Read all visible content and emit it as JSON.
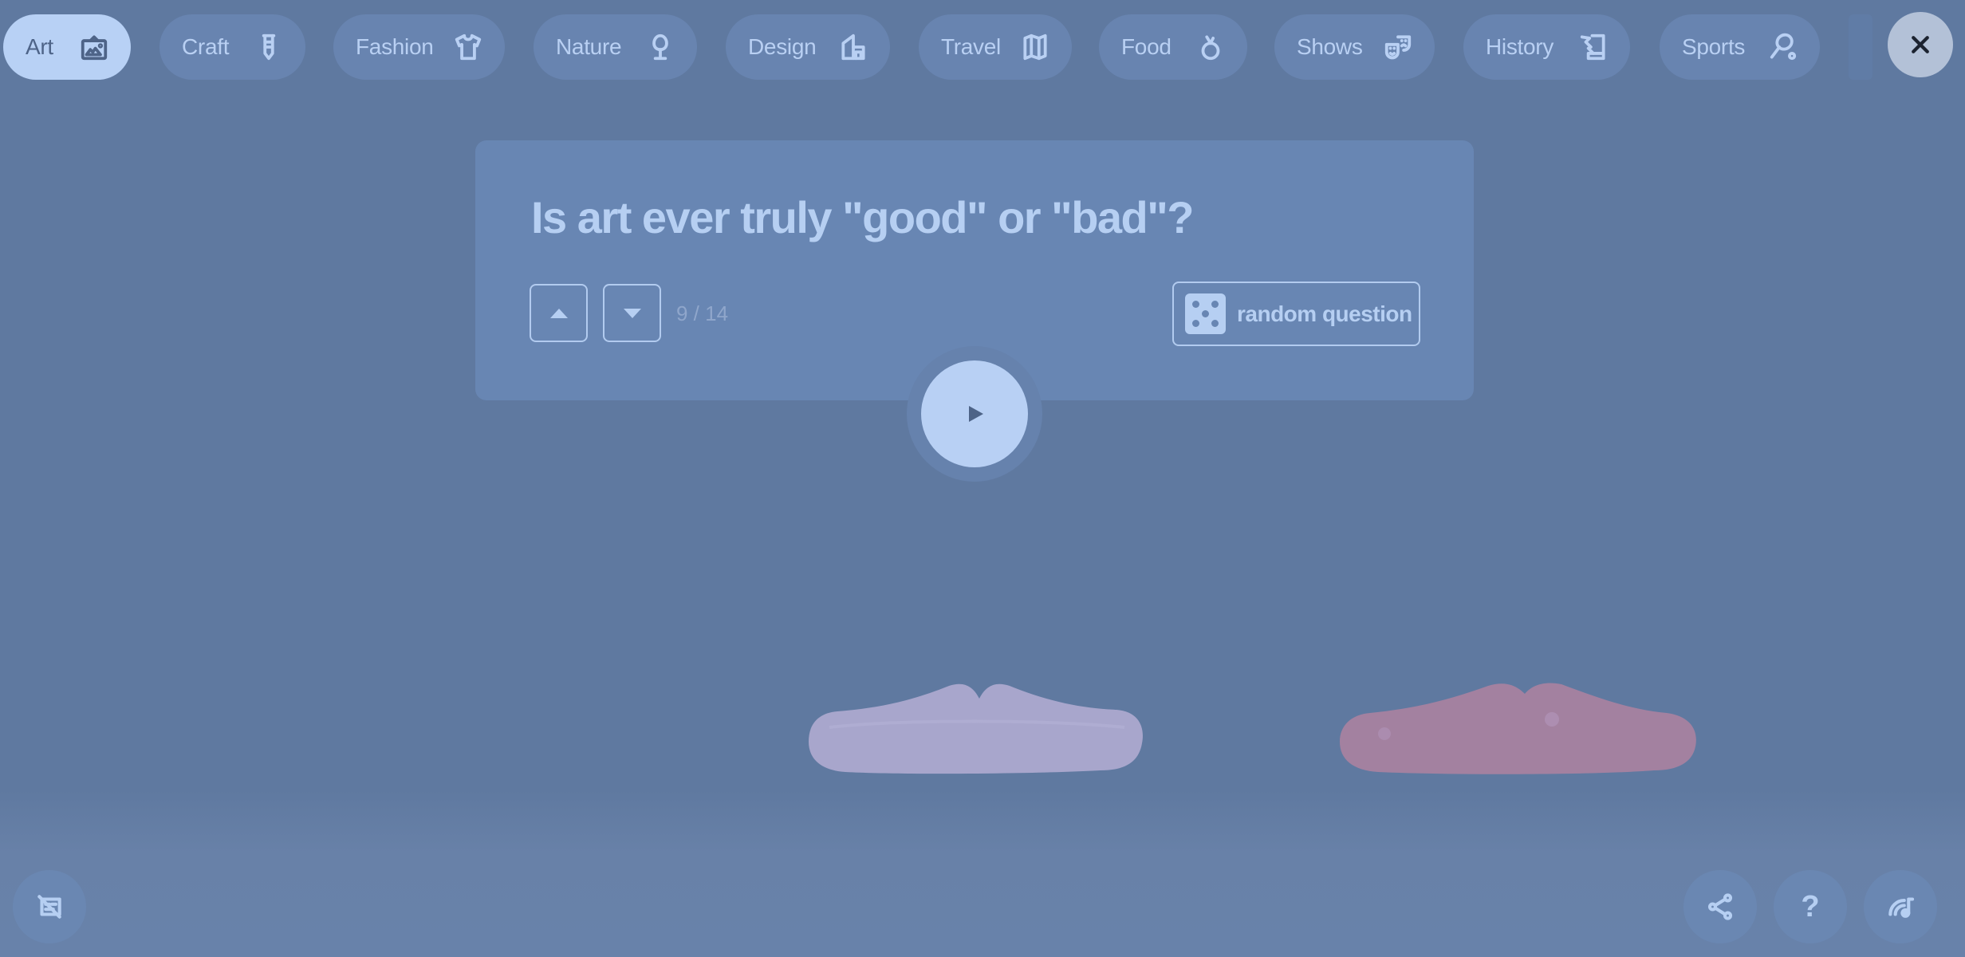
{
  "categories": [
    {
      "label": "Art",
      "icon": "framed-picture-icon",
      "active": true
    },
    {
      "label": "Craft",
      "icon": "screw-icon",
      "active": false
    },
    {
      "label": "Fashion",
      "icon": "t-shirt-icon",
      "active": false
    },
    {
      "label": "Nature",
      "icon": "tree-icon",
      "active": false
    },
    {
      "label": "Design",
      "icon": "building-icon",
      "active": false
    },
    {
      "label": "Travel",
      "icon": "map-icon",
      "active": false
    },
    {
      "label": "Food",
      "icon": "apple-icon",
      "active": false
    },
    {
      "label": "Shows",
      "icon": "theater-masks-icon",
      "active": false
    },
    {
      "label": "History",
      "icon": "scroll-quill-icon",
      "active": false
    },
    {
      "label": "Sports",
      "icon": "tennis-racket-icon",
      "active": false
    }
  ],
  "close": {
    "icon": "close-icon"
  },
  "question": {
    "text": "Is art ever truly \"good\" or \"bad\"?",
    "current": 9,
    "total": 14,
    "counter": "9 / 14"
  },
  "random_button": {
    "label": "random question",
    "icon": "dice-icon"
  },
  "play": {
    "icon": "play-icon"
  },
  "speakers": [
    {
      "name": "lips-left",
      "color": "#a8a6cc"
    },
    {
      "name": "lips-right",
      "color": "#a381a0"
    }
  ],
  "bottom_controls": {
    "captions": {
      "icon": "captions-off-icon"
    },
    "share": {
      "icon": "share-icon"
    },
    "help": {
      "icon": "help-icon",
      "glyph": "?"
    },
    "music": {
      "icon": "music-broadcast-icon"
    }
  },
  "colors": {
    "background": "#5f7aa0",
    "card": "#6886b3",
    "accent": "#b8d1f5",
    "chip": "#6884b0"
  }
}
